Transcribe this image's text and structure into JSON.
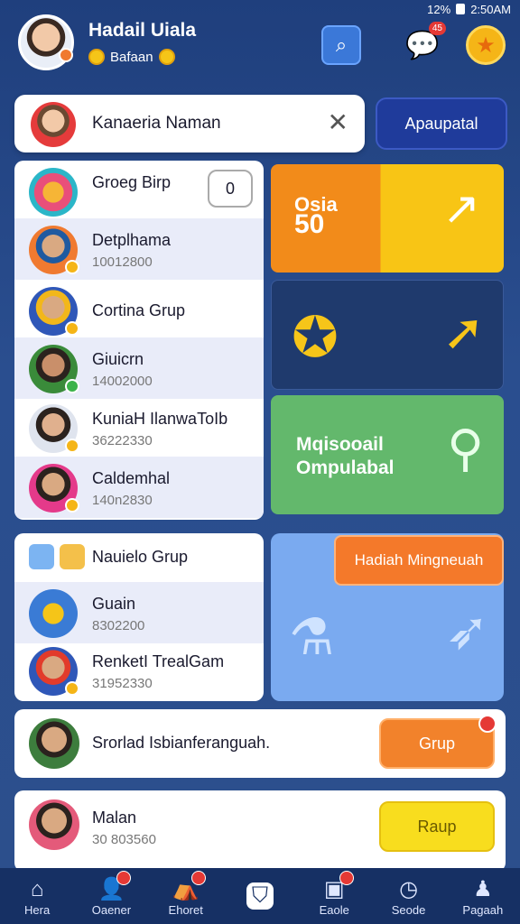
{
  "status": {
    "time": "2:50AM",
    "signal": "12%"
  },
  "header": {
    "name": "Hadail Uiala",
    "sub": "Bafaan"
  },
  "search": {
    "value": "Kanaeria Naman",
    "apply_label": "Apaupatal"
  },
  "groups": {
    "count": "0",
    "items": [
      {
        "title": "Groeg Birp",
        "sub": ""
      },
      {
        "title": "Detplhama",
        "sub": "10012800"
      },
      {
        "title": "Cortina Grup",
        "sub": ""
      },
      {
        "title": "Giuicrn",
        "sub": "14002000"
      },
      {
        "title": "KuniaH IlanwaToIb",
        "sub": "36222330"
      },
      {
        "title": "Caldemhal",
        "sub": "140n2830"
      }
    ]
  },
  "tiles": {
    "t1_label_top": "Osia",
    "t1_label_bottom": "50",
    "t3_label_1": "Mqisooail",
    "t3_label_2": "Ompulabal"
  },
  "nearby": {
    "title": "Nauielo Grup",
    "items": [
      {
        "title": "Guain",
        "sub": "8302200"
      },
      {
        "title": "RenketI TrealGam",
        "sub": "31952330"
      }
    ]
  },
  "promo": {
    "label": "Hadiah Mingneuah"
  },
  "suggest": {
    "text": "Srorlad Isbianferanguah.",
    "cta": "Grup"
  },
  "friend": {
    "title": "Malan",
    "sub": "30 803560",
    "cta": "Raup"
  },
  "nav": [
    {
      "label": "Hera"
    },
    {
      "label": "Oaener"
    },
    {
      "label": "Ehoret"
    },
    {
      "label": ""
    },
    {
      "label": "Eaole"
    },
    {
      "label": "Seode"
    },
    {
      "label": "Pagaah"
    }
  ],
  "colors": {
    "accent": "#1f3b9b",
    "orange": "#f2822b",
    "yellow": "#f8c515",
    "green": "#63b86c"
  }
}
